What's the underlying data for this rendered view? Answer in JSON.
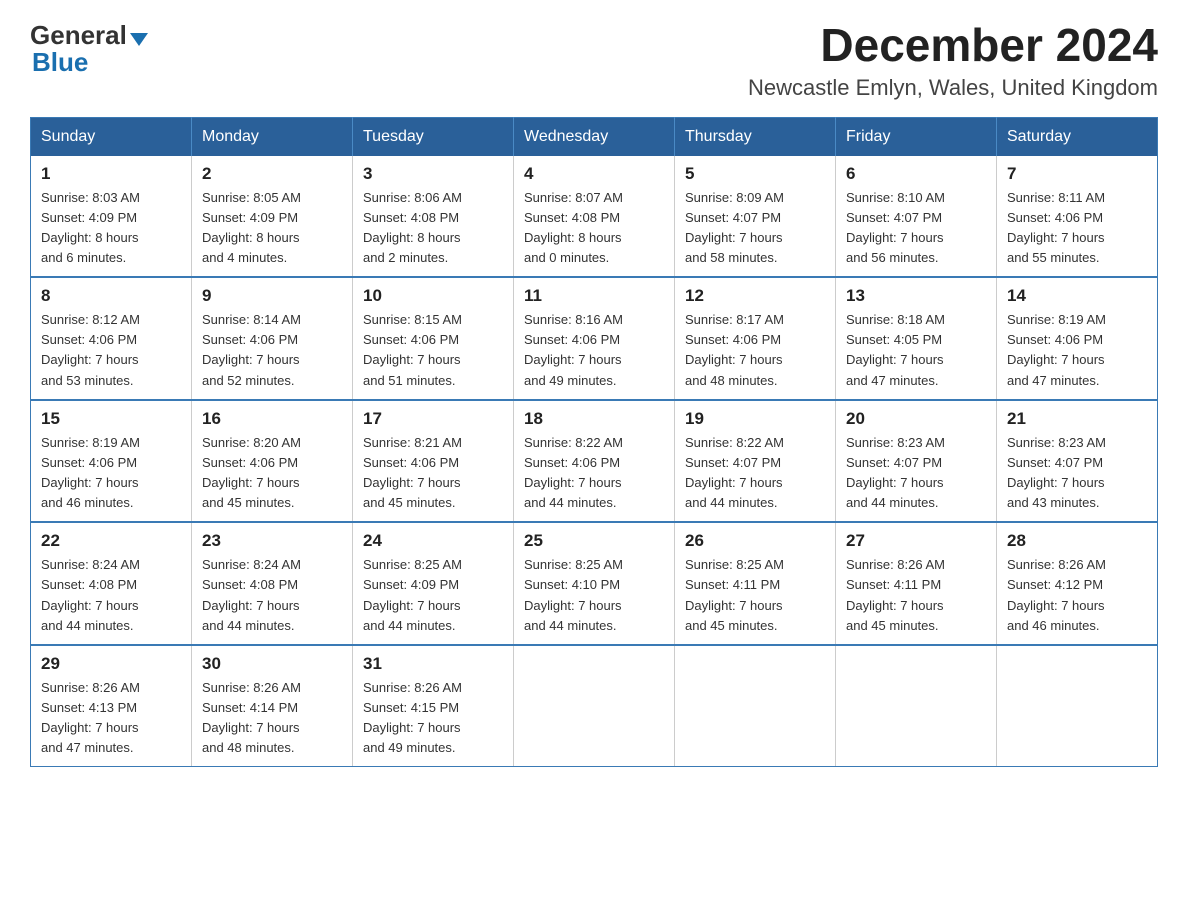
{
  "header": {
    "logo_general": "General",
    "logo_blue": "Blue",
    "title": "December 2024",
    "subtitle": "Newcastle Emlyn, Wales, United Kingdom"
  },
  "weekdays": [
    "Sunday",
    "Monday",
    "Tuesday",
    "Wednesday",
    "Thursday",
    "Friday",
    "Saturday"
  ],
  "weeks": [
    [
      {
        "day": "1",
        "sunrise": "Sunrise: 8:03 AM",
        "sunset": "Sunset: 4:09 PM",
        "daylight": "Daylight: 8 hours",
        "minutes": "and 6 minutes."
      },
      {
        "day": "2",
        "sunrise": "Sunrise: 8:05 AM",
        "sunset": "Sunset: 4:09 PM",
        "daylight": "Daylight: 8 hours",
        "minutes": "and 4 minutes."
      },
      {
        "day": "3",
        "sunrise": "Sunrise: 8:06 AM",
        "sunset": "Sunset: 4:08 PM",
        "daylight": "Daylight: 8 hours",
        "minutes": "and 2 minutes."
      },
      {
        "day": "4",
        "sunrise": "Sunrise: 8:07 AM",
        "sunset": "Sunset: 4:08 PM",
        "daylight": "Daylight: 8 hours",
        "minutes": "and 0 minutes."
      },
      {
        "day": "5",
        "sunrise": "Sunrise: 8:09 AM",
        "sunset": "Sunset: 4:07 PM",
        "daylight": "Daylight: 7 hours",
        "minutes": "and 58 minutes."
      },
      {
        "day": "6",
        "sunrise": "Sunrise: 8:10 AM",
        "sunset": "Sunset: 4:07 PM",
        "daylight": "Daylight: 7 hours",
        "minutes": "and 56 minutes."
      },
      {
        "day": "7",
        "sunrise": "Sunrise: 8:11 AM",
        "sunset": "Sunset: 4:06 PM",
        "daylight": "Daylight: 7 hours",
        "minutes": "and 55 minutes."
      }
    ],
    [
      {
        "day": "8",
        "sunrise": "Sunrise: 8:12 AM",
        "sunset": "Sunset: 4:06 PM",
        "daylight": "Daylight: 7 hours",
        "minutes": "and 53 minutes."
      },
      {
        "day": "9",
        "sunrise": "Sunrise: 8:14 AM",
        "sunset": "Sunset: 4:06 PM",
        "daylight": "Daylight: 7 hours",
        "minutes": "and 52 minutes."
      },
      {
        "day": "10",
        "sunrise": "Sunrise: 8:15 AM",
        "sunset": "Sunset: 4:06 PM",
        "daylight": "Daylight: 7 hours",
        "minutes": "and 51 minutes."
      },
      {
        "day": "11",
        "sunrise": "Sunrise: 8:16 AM",
        "sunset": "Sunset: 4:06 PM",
        "daylight": "Daylight: 7 hours",
        "minutes": "and 49 minutes."
      },
      {
        "day": "12",
        "sunrise": "Sunrise: 8:17 AM",
        "sunset": "Sunset: 4:06 PM",
        "daylight": "Daylight: 7 hours",
        "minutes": "and 48 minutes."
      },
      {
        "day": "13",
        "sunrise": "Sunrise: 8:18 AM",
        "sunset": "Sunset: 4:05 PM",
        "daylight": "Daylight: 7 hours",
        "minutes": "and 47 minutes."
      },
      {
        "day": "14",
        "sunrise": "Sunrise: 8:19 AM",
        "sunset": "Sunset: 4:06 PM",
        "daylight": "Daylight: 7 hours",
        "minutes": "and 47 minutes."
      }
    ],
    [
      {
        "day": "15",
        "sunrise": "Sunrise: 8:19 AM",
        "sunset": "Sunset: 4:06 PM",
        "daylight": "Daylight: 7 hours",
        "minutes": "and 46 minutes."
      },
      {
        "day": "16",
        "sunrise": "Sunrise: 8:20 AM",
        "sunset": "Sunset: 4:06 PM",
        "daylight": "Daylight: 7 hours",
        "minutes": "and 45 minutes."
      },
      {
        "day": "17",
        "sunrise": "Sunrise: 8:21 AM",
        "sunset": "Sunset: 4:06 PM",
        "daylight": "Daylight: 7 hours",
        "minutes": "and 45 minutes."
      },
      {
        "day": "18",
        "sunrise": "Sunrise: 8:22 AM",
        "sunset": "Sunset: 4:06 PM",
        "daylight": "Daylight: 7 hours",
        "minutes": "and 44 minutes."
      },
      {
        "day": "19",
        "sunrise": "Sunrise: 8:22 AM",
        "sunset": "Sunset: 4:07 PM",
        "daylight": "Daylight: 7 hours",
        "minutes": "and 44 minutes."
      },
      {
        "day": "20",
        "sunrise": "Sunrise: 8:23 AM",
        "sunset": "Sunset: 4:07 PM",
        "daylight": "Daylight: 7 hours",
        "minutes": "and 44 minutes."
      },
      {
        "day": "21",
        "sunrise": "Sunrise: 8:23 AM",
        "sunset": "Sunset: 4:07 PM",
        "daylight": "Daylight: 7 hours",
        "minutes": "and 43 minutes."
      }
    ],
    [
      {
        "day": "22",
        "sunrise": "Sunrise: 8:24 AM",
        "sunset": "Sunset: 4:08 PM",
        "daylight": "Daylight: 7 hours",
        "minutes": "and 44 minutes."
      },
      {
        "day": "23",
        "sunrise": "Sunrise: 8:24 AM",
        "sunset": "Sunset: 4:08 PM",
        "daylight": "Daylight: 7 hours",
        "minutes": "and 44 minutes."
      },
      {
        "day": "24",
        "sunrise": "Sunrise: 8:25 AM",
        "sunset": "Sunset: 4:09 PM",
        "daylight": "Daylight: 7 hours",
        "minutes": "and 44 minutes."
      },
      {
        "day": "25",
        "sunrise": "Sunrise: 8:25 AM",
        "sunset": "Sunset: 4:10 PM",
        "daylight": "Daylight: 7 hours",
        "minutes": "and 44 minutes."
      },
      {
        "day": "26",
        "sunrise": "Sunrise: 8:25 AM",
        "sunset": "Sunset: 4:11 PM",
        "daylight": "Daylight: 7 hours",
        "minutes": "and 45 minutes."
      },
      {
        "day": "27",
        "sunrise": "Sunrise: 8:26 AM",
        "sunset": "Sunset: 4:11 PM",
        "daylight": "Daylight: 7 hours",
        "minutes": "and 45 minutes."
      },
      {
        "day": "28",
        "sunrise": "Sunrise: 8:26 AM",
        "sunset": "Sunset: 4:12 PM",
        "daylight": "Daylight: 7 hours",
        "minutes": "and 46 minutes."
      }
    ],
    [
      {
        "day": "29",
        "sunrise": "Sunrise: 8:26 AM",
        "sunset": "Sunset: 4:13 PM",
        "daylight": "Daylight: 7 hours",
        "minutes": "and 47 minutes."
      },
      {
        "day": "30",
        "sunrise": "Sunrise: 8:26 AM",
        "sunset": "Sunset: 4:14 PM",
        "daylight": "Daylight: 7 hours",
        "minutes": "and 48 minutes."
      },
      {
        "day": "31",
        "sunrise": "Sunrise: 8:26 AM",
        "sunset": "Sunset: 4:15 PM",
        "daylight": "Daylight: 7 hours",
        "minutes": "and 49 minutes."
      },
      {
        "day": "",
        "sunrise": "",
        "sunset": "",
        "daylight": "",
        "minutes": ""
      },
      {
        "day": "",
        "sunrise": "",
        "sunset": "",
        "daylight": "",
        "minutes": ""
      },
      {
        "day": "",
        "sunrise": "",
        "sunset": "",
        "daylight": "",
        "minutes": ""
      },
      {
        "day": "",
        "sunrise": "",
        "sunset": "",
        "daylight": "",
        "minutes": ""
      }
    ]
  ]
}
